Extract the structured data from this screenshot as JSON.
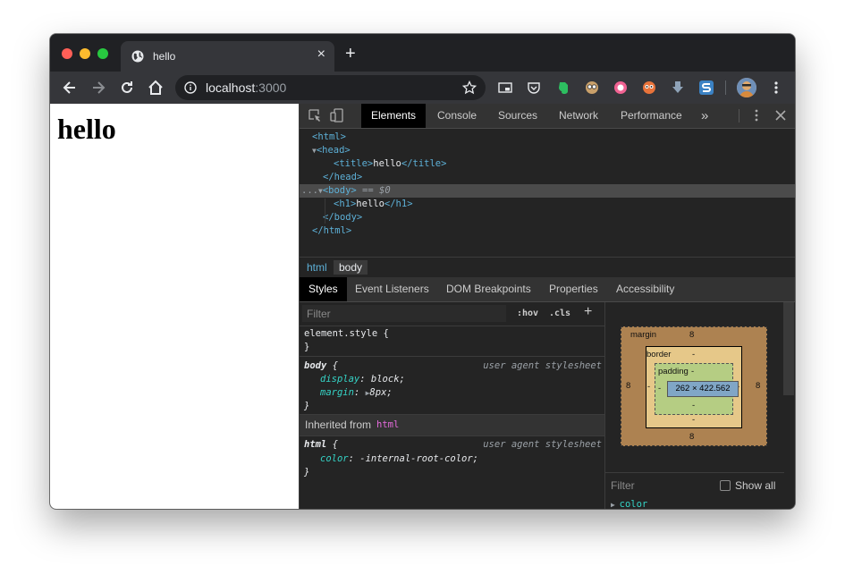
{
  "browser": {
    "tab_title": "hello",
    "url_host": "localhost",
    "url_port": ":3000",
    "new_tab_label": "+",
    "close_tab_label": "×"
  },
  "page": {
    "heading": "hello"
  },
  "devtools": {
    "tabs": [
      "Elements",
      "Console",
      "Sources",
      "Network",
      "Performance"
    ],
    "more_tabs_label": "»",
    "tree": {
      "html_open": "<html>",
      "head_open": "<head>",
      "title_open": "<title>",
      "title_text": "hello",
      "title_close": "</title>",
      "head_close": "</head>",
      "ellipsis": "...",
      "body_open": "<body>",
      "selected_marker": " == $0",
      "h1_open": "<h1>",
      "h1_text": "hello",
      "h1_close": "</h1>",
      "body_close": "</body>",
      "html_close": "</html>"
    },
    "breadcrumbs": [
      "html",
      "body"
    ],
    "subtabs": [
      "Styles",
      "Event Listeners",
      "DOM Breakpoints",
      "Properties",
      "Accessibility"
    ],
    "styles": {
      "filter_placeholder": "Filter",
      "hov": ":hov",
      "cls": ".cls",
      "add": "+",
      "element_style": "element.style {",
      "close_brace": "}",
      "body_selector": "body",
      "open_brace": " {",
      "ua_label": "user agent stylesheet",
      "display_prop": "display",
      "display_val": ": block;",
      "margin_prop": "margin",
      "margin_val": "8px;",
      "inherited_label": "Inherited from ",
      "inherited_tag": "html",
      "html_selector": "html",
      "color_prop": "color",
      "color_val": ": -internal-root-color;"
    },
    "box_model": {
      "margin_label": "margin",
      "margin_top": "8",
      "margin_bottom": "8",
      "margin_left": "8",
      "margin_right": "8",
      "border_label": "border",
      "border_top": "-",
      "border_bottom": "-",
      "border_left": "-",
      "border_right": "-",
      "padding_label": "padding",
      "padding_top": "-",
      "padding_bottom": "-",
      "padding_left": "-",
      "padding_right": "-",
      "content_size": "262 × 422.562",
      "filter_placeholder": "Filter",
      "show_all": "Show all",
      "computed_prop": "color"
    }
  },
  "colors": {
    "selector_tag": "#5db0d7",
    "inherited_tag": "#e56bdc",
    "css_property": "#35d4c7"
  }
}
